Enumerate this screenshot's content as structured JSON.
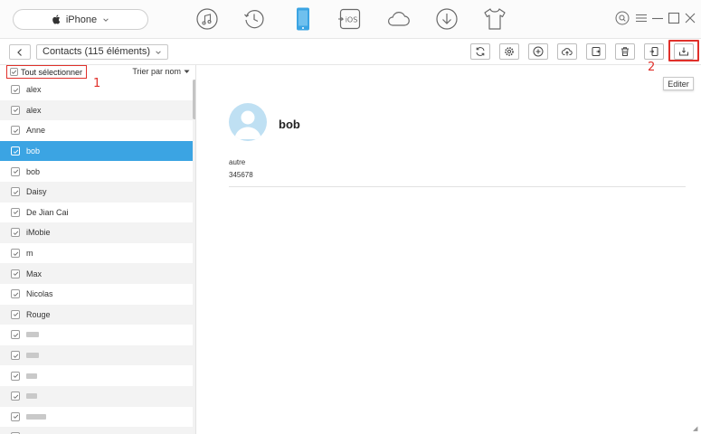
{
  "header": {
    "device_name": "iPhone",
    "nav_icons": [
      "music-icon",
      "history-icon",
      "phone-icon",
      "ios-icon",
      "cloud-icon",
      "download-icon",
      "tshirt-icon"
    ],
    "window_controls": [
      "search-icon",
      "menu-icon",
      "minimize-icon",
      "maximize-icon",
      "close-icon"
    ],
    "accent_color": "#3ba4e3"
  },
  "toolbar": {
    "breadcrumb": "Contacts (115 éléments)",
    "action_icons": [
      "refresh-icon",
      "settings-icon",
      "add-icon",
      "upload-cloud-icon",
      "to-pc-icon",
      "delete-icon",
      "to-device-icon",
      "export-icon"
    ],
    "tooltip": "Editer",
    "highlight_color": "#e0302a",
    "marker_1": "1",
    "marker_2": "2"
  },
  "list": {
    "select_all_label": "Tout sélectionner",
    "sort_label": "Trier par nom",
    "rows": [
      {
        "name": "alex",
        "selected": false
      },
      {
        "name": "alex",
        "selected": false
      },
      {
        "name": "Anne",
        "selected": false
      },
      {
        "name": "bob",
        "selected": true
      },
      {
        "name": "bob",
        "selected": false
      },
      {
        "name": "Daisy",
        "selected": false
      },
      {
        "name": "De Jian Cai",
        "selected": false
      },
      {
        "name": "iMobie",
        "selected": false
      },
      {
        "name": "m",
        "selected": false
      },
      {
        "name": "Max",
        "selected": false
      },
      {
        "name": "Nicolas",
        "selected": false
      },
      {
        "name": "Rouge",
        "selected": false
      }
    ]
  },
  "detail": {
    "name": "bob",
    "field_label": "autre",
    "field_value": "345678"
  }
}
